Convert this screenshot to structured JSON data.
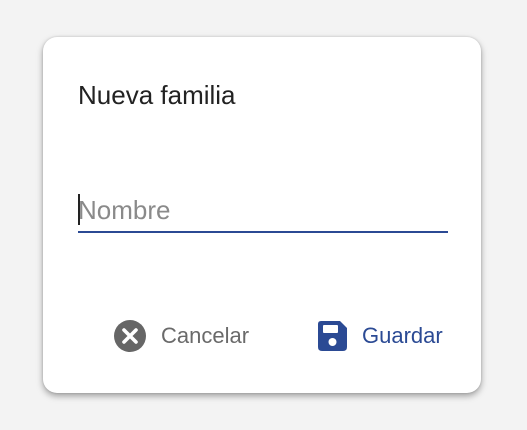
{
  "dialog": {
    "title": "Nueva familia",
    "name_field": {
      "value": "",
      "placeholder": "Nombre"
    },
    "actions": {
      "cancel_label": "Cancelar",
      "cancel_icon": "cancel-circle-icon",
      "save_label": "Guardar",
      "save_icon": "floppy-disk-icon"
    }
  },
  "colors": {
    "accent": "#2b4a94",
    "cancel_icon": "#666666",
    "muted_text": "#6a6a6a",
    "title_text": "#222222"
  }
}
